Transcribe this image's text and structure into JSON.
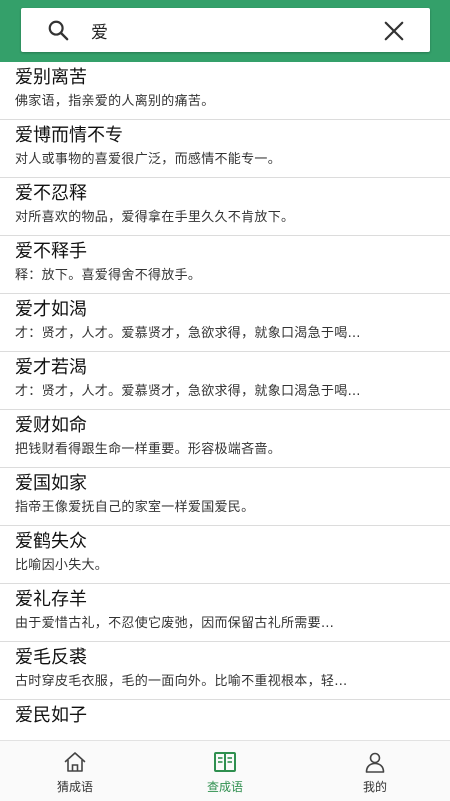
{
  "search": {
    "query": "爱",
    "icon": "search-icon",
    "clear_icon": "close-icon"
  },
  "colors": {
    "header": "#34a06a",
    "active_tab": "#2f8f4f"
  },
  "results": [
    {
      "title": "爱别离苦",
      "desc": "佛家语，指亲爱的人离别的痛苦。"
    },
    {
      "title": "爱博而情不专",
      "desc": "对人或事物的喜爱很广泛，而感情不能专一。"
    },
    {
      "title": "爱不忍释",
      "desc": "对所喜欢的物品，爱得拿在手里久久不肯放下。"
    },
    {
      "title": "爱不释手",
      "desc": "释：放下。喜爱得舍不得放手。"
    },
    {
      "title": "爱才如渴",
      "desc": "才：贤才，人才。爱慕贤才，急欲求得，就象口渴急于喝…"
    },
    {
      "title": "爱才若渴",
      "desc": "才：贤才，人才。爱慕贤才，急欲求得，就象口渴急于喝…"
    },
    {
      "title": "爱财如命",
      "desc": "把钱财看得跟生命一样重要。形容极端吝啬。"
    },
    {
      "title": "爱国如家",
      "desc": "指帝王像爱抚自己的家室一样爱国爱民。"
    },
    {
      "title": "爱鹤失众",
      "desc": "比喻因小失大。"
    },
    {
      "title": "爱礼存羊",
      "desc": "由于爱惜古礼，不忍使它废弛，因而保留古礼所需要…"
    },
    {
      "title": "爱毛反裘",
      "desc": "古时穿皮毛衣服，毛的一面向外。比喻不重视根本，轻…"
    },
    {
      "title": "爱民如子",
      "desc": ""
    }
  ],
  "nav": {
    "tabs": [
      {
        "label": "猜成语",
        "icon": "home-icon"
      },
      {
        "label": "查成语",
        "icon": "book-icon"
      },
      {
        "label": "我的",
        "icon": "user-icon"
      }
    ],
    "active_index": 1
  }
}
